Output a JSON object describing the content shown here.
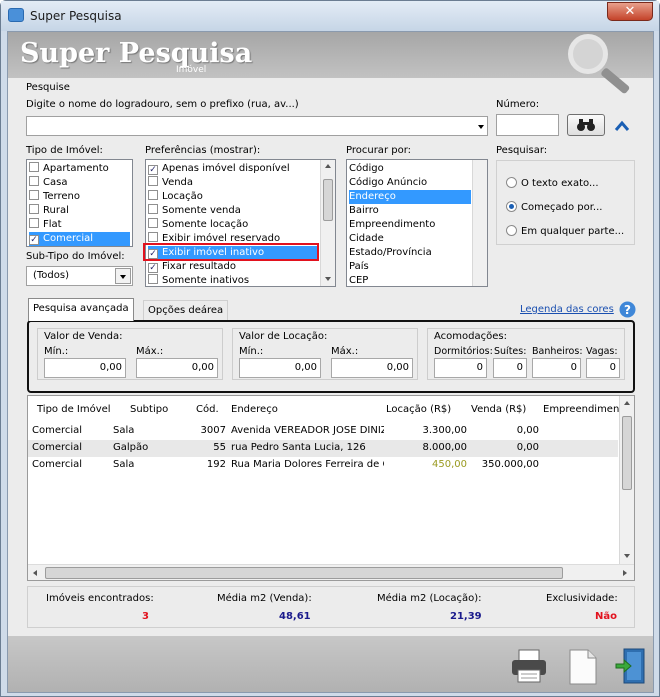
{
  "window": {
    "title": "Super Pesquisa",
    "close_label": "✕"
  },
  "banner": {
    "title": "Super Pesquisa",
    "subtitle": "Imóvel"
  },
  "pesquise": {
    "section_label": "Pesquise",
    "street_label": "Digite o nome do logradouro, sem o prefixo (rua, av...)",
    "street_value": "",
    "numero_label": "Número:",
    "numero_value": ""
  },
  "tipo_imovel": {
    "label": "Tipo de Imóvel:",
    "items": [
      {
        "label": "Apartamento",
        "checked": false,
        "selected": false
      },
      {
        "label": "Casa",
        "checked": false,
        "selected": false
      },
      {
        "label": "Terreno",
        "checked": false,
        "selected": false
      },
      {
        "label": "Rural",
        "checked": false,
        "selected": false
      },
      {
        "label": "Flat",
        "checked": false,
        "selected": false
      },
      {
        "label": "Comercial",
        "checked": true,
        "selected": true
      }
    ]
  },
  "subtipo": {
    "label": "Sub-Tipo do Imóvel:",
    "value": "(Todos)"
  },
  "preferencias": {
    "label": "Preferências (mostrar):",
    "items": [
      {
        "label": "Apenas imóvel disponível",
        "checked": true,
        "selected": false
      },
      {
        "label": "Venda",
        "checked": false,
        "selected": false
      },
      {
        "label": "Locação",
        "checked": false,
        "selected": false
      },
      {
        "label": "Somente venda",
        "checked": false,
        "selected": false
      },
      {
        "label": "Somente locação",
        "checked": false,
        "selected": false
      },
      {
        "label": "Exibir imóvel reservado",
        "checked": false,
        "selected": false
      },
      {
        "label": "Exibir imóvel inativo",
        "checked": true,
        "selected": true
      },
      {
        "label": "Fixar resultado",
        "checked": true,
        "selected": false
      },
      {
        "label": "Somente inativos",
        "checked": false,
        "selected": false
      }
    ]
  },
  "procurar": {
    "label": "Procurar por:",
    "items": [
      {
        "label": "Código",
        "selected": false
      },
      {
        "label": "Código Anúncio",
        "selected": false
      },
      {
        "label": "Endereço",
        "selected": true
      },
      {
        "label": "Bairro",
        "selected": false
      },
      {
        "label": "Empreendimento",
        "selected": false
      },
      {
        "label": "Cidade",
        "selected": false
      },
      {
        "label": "Estado/Província",
        "selected": false
      },
      {
        "label": "País",
        "selected": false
      },
      {
        "label": "CEP",
        "selected": false
      }
    ]
  },
  "pesquisar": {
    "label": "Pesquisar:",
    "options": [
      {
        "label": "O texto exato...",
        "selected": false
      },
      {
        "label": "Começado por...",
        "selected": true
      },
      {
        "label": "Em qualquer parte...",
        "selected": false
      }
    ]
  },
  "tabs": [
    {
      "label": "Pesquisa avançada",
      "active": true
    },
    {
      "label": "Opções deárea",
      "active": false
    }
  ],
  "legenda": "Legenda das cores",
  "advanced": {
    "venda": {
      "label": "Valor de Venda:",
      "min_label": "Mín.:",
      "max_label": "Máx.:",
      "min": "0,00",
      "max": "0,00"
    },
    "locacao": {
      "label": "Valor de Locação:",
      "min_label": "Mín.:",
      "max_label": "Máx.:",
      "min": "0,00",
      "max": "0,00"
    },
    "acomodacoes": {
      "label": "Acomodações:",
      "fields": [
        {
          "label": "Dormitórios:",
          "value": "0"
        },
        {
          "label": "Suítes:",
          "value": "0"
        },
        {
          "label": "Banheiros:",
          "value": "0"
        },
        {
          "label": "Vagas:",
          "value": "0"
        }
      ]
    }
  },
  "results": {
    "columns": [
      "Tipo de Imóvel",
      "Subtipo",
      "Cód.",
      "Endereço",
      "Locação (R$)",
      "Venda (R$)",
      "Empreendimento"
    ],
    "rows": [
      {
        "tipo": "Comercial",
        "subtipo": "Sala",
        "cod": "3007",
        "endereco": "Avenida VEREADOR JOSE DINIZ",
        "locacao": "3.300,00",
        "venda": "0,00",
        "empreendimento": ""
      },
      {
        "tipo": "Comercial",
        "subtipo": "Galpão",
        "cod": "55",
        "endereco": "rua Pedro Santa Lucia, 126",
        "locacao": "8.000,00",
        "venda": "0,00",
        "empreendimento": ""
      },
      {
        "tipo": "Comercial",
        "subtipo": "Sala",
        "cod": "192",
        "endereco": "Rua Maria Dolores Ferreira de C",
        "locacao": "450,00",
        "venda": "350.000,00",
        "empreendimento": ""
      }
    ]
  },
  "summary": {
    "encontrados_label": "Imóveis encontrados:",
    "encontrados_value": "3",
    "media_venda_label": "Média m2 (Venda):",
    "media_venda_value": "48,61",
    "media_locacao_label": "Média m2 (Locação):",
    "media_locacao_value": "21,39",
    "exclusividade_label": "Exclusividade:",
    "exclusividade_value": "Não"
  },
  "colors": {
    "selection": "#3399ff",
    "red_value": "#e2121e",
    "blue_value": "#1a1a8c",
    "olive_value": "#9a9a20"
  },
  "icons": [
    "app-icon",
    "close-icon",
    "magnifier-icon",
    "binoculars-icon",
    "chevron-up-icon",
    "help-icon",
    "printer-icon",
    "document-icon",
    "exit-door-icon"
  ]
}
